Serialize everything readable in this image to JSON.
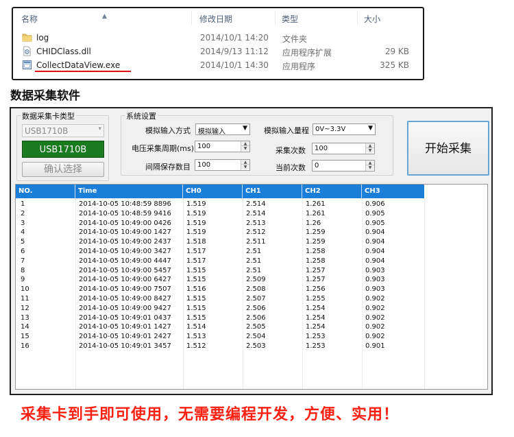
{
  "explorer": {
    "columns": [
      "名称",
      "修改日期",
      "类型",
      "大小"
    ],
    "files": [
      {
        "name": "log",
        "date": "2014/10/1 14:20",
        "type": "文件夹",
        "size": "",
        "icon": "folder-icon"
      },
      {
        "name": "CHIDClass.dll",
        "date": "2014/9/13 11:12",
        "type": "应用程序扩展",
        "size": "29 KB",
        "icon": "dll-file-icon"
      },
      {
        "name": "CollectDataView.exe",
        "date": "2014/10/1 14:30",
        "type": "应用程序",
        "size": "325 KB",
        "icon": "exe-file-icon"
      }
    ],
    "highlight_color": "#e01010"
  },
  "section_title": "数据采集软件",
  "app": {
    "card_type_label": "数据采集卡类型",
    "card_type_value": "USB1710B",
    "device_display": "USB1710B",
    "confirm_button": "确认选择",
    "settings_title": "系统设置",
    "analog_mode_label": "模拟输入方式",
    "analog_mode_value": "模拟输入",
    "analog_range_label": "模拟输入量程",
    "analog_range_value": "0V~3.3V",
    "voltage_period_label": "电压采集周期(ms)",
    "voltage_period_value": "100",
    "sample_count_label": "采集次数",
    "sample_count_value": "100",
    "save_interval_label": "间隔保存数目",
    "save_interval_value": "100",
    "current_count_label": "当前次数",
    "current_count_value": "0",
    "start_button": "开始采集",
    "header_color": "#1b7ed8"
  },
  "table": {
    "headers": [
      "NO.",
      "Time",
      "CH0",
      "CH1",
      "CH2",
      "CH3"
    ],
    "rows": [
      [
        "1",
        "2014-10-05 10:48:59 8896",
        "1.519",
        "2.514",
        "1.261",
        "0.906"
      ],
      [
        "2",
        "2014-10-05 10:48:59 9416",
        "1.519",
        "2.514",
        "1.261",
        "0.905"
      ],
      [
        "3",
        "2014-10-05 10:49:00 0426",
        "1.519",
        "2.513",
        "1.26",
        "0.905"
      ],
      [
        "4",
        "2014-10-05 10:49:00 1427",
        "1.519",
        "2.512",
        "1.259",
        "0.904"
      ],
      [
        "5",
        "2014-10-05 10:49:00 2437",
        "1.518",
        "2.511",
        "1.259",
        "0.904"
      ],
      [
        "6",
        "2014-10-05 10:49:00 3427",
        "1.517",
        "2.51",
        "1.258",
        "0.904"
      ],
      [
        "7",
        "2014-10-05 10:49:00 4447",
        "1.517",
        "2.51",
        "1.258",
        "0.904"
      ],
      [
        "8",
        "2014-10-05 10:49:00 5457",
        "1.515",
        "2.51",
        "1.257",
        "0.903"
      ],
      [
        "9",
        "2014-10-05 10:49:00 6427",
        "1.515",
        "2.509",
        "1.257",
        "0.903"
      ],
      [
        "10",
        "2014-10-05 10:49:00 7507",
        "1.516",
        "2.508",
        "1.256",
        "0.903"
      ],
      [
        "11",
        "2014-10-05 10:49:00 8427",
        "1.515",
        "2.507",
        "1.255",
        "0.902"
      ],
      [
        "12",
        "2014-10-05 10:49:00 9427",
        "1.515",
        "2.506",
        "1.254",
        "0.902"
      ],
      [
        "13",
        "2014-10-05 10:49:01 0437",
        "1.515",
        "2.506",
        "1.254",
        "0.902"
      ],
      [
        "14",
        "2014-10-05 10:49:01 1427",
        "1.514",
        "2.505",
        "1.254",
        "0.902"
      ],
      [
        "15",
        "2014-10-05 10:49:01 2427",
        "1.513",
        "2.504",
        "1.253",
        "0.902"
      ],
      [
        "16",
        "2014-10-05 10:49:01 3457",
        "1.512",
        "2.503",
        "1.253",
        "0.901"
      ]
    ]
  },
  "slogan": "采集卡到手即可使用，无需要编程开发，方便、实用！",
  "slogan_color": "#ff1f10"
}
